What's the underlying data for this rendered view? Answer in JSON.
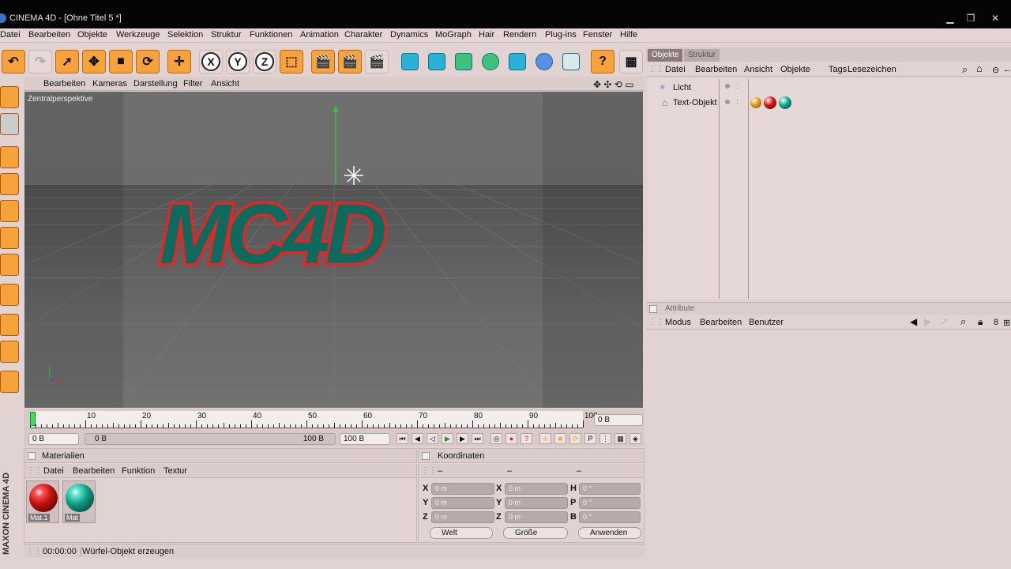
{
  "window": {
    "title": "CINEMA 4D - [Ohne Titel 5 *]"
  },
  "menu": [
    "Datei",
    "Bearbeiten",
    "Objekte",
    "Werkzeuge",
    "Selektion",
    "Struktur",
    "Funktionen",
    "Animation",
    "Charakter",
    "Dynamics",
    "MoGraph",
    "Hair",
    "Rendern",
    "Plug-ins",
    "Fenster",
    "Hilfe"
  ],
  "toolbar": {
    "axis_x": "X",
    "axis_y": "Y",
    "axis_z": "Z"
  },
  "viewport": {
    "menu": [
      "Bearbeiten",
      "Kameras",
      "Darstellung",
      "Filter",
      "Ansicht"
    ],
    "label": "Zentralperspektive",
    "scene_text": "MC4D"
  },
  "timeline": {
    "ticks": [
      "0",
      "10",
      "20",
      "30",
      "40",
      "50",
      "60",
      "70",
      "80",
      "90",
      "100"
    ],
    "current_frame": "0 B",
    "start_field": "0 B",
    "range_start": "0 B",
    "range_end": "100 B",
    "end_field": "100 B"
  },
  "materials": {
    "title": "Materialien",
    "menu": [
      "Datei",
      "Bearbeiten",
      "Funktion",
      "Textur"
    ],
    "items": [
      {
        "label": "Mat.1",
        "color": "#d81616"
      },
      {
        "label": "Mat",
        "color": "#10a88f"
      }
    ]
  },
  "coordinates": {
    "title": "Koordinaten",
    "col_headers": [
      "–",
      "–",
      "–"
    ],
    "rows": [
      {
        "a": "X",
        "av": "0 m",
        "b": "X",
        "bv": "0 m",
        "c": "H",
        "cv": "0 °"
      },
      {
        "a": "Y",
        "av": "0 m",
        "b": "Y",
        "bv": "0 m",
        "c": "P",
        "cv": "0 °"
      },
      {
        "a": "Z",
        "av": "0 m",
        "b": "Z",
        "bv": "0 m",
        "c": "B",
        "cv": "0 °"
      }
    ],
    "mode": "Welt",
    "size_mode": "Größe",
    "apply": "Anwenden"
  },
  "status": {
    "time": "00:00:00",
    "message": "Würfel-Objekt erzeugen"
  },
  "brand": {
    "text": "MAXON CINEMA 4D"
  },
  "objects": {
    "tabs": [
      "Objekte",
      "Struktur"
    ],
    "menu": [
      "Datei",
      "Bearbeiten",
      "Ansicht",
      "Objekte",
      "Tags",
      "Lesezeichen"
    ],
    "items": [
      {
        "name": "Licht"
      },
      {
        "name": "Text-Objekt"
      }
    ]
  },
  "attributes": {
    "title": "Attribute",
    "menu": [
      "Modus",
      "Bearbeiten",
      "Benutzer"
    ]
  },
  "colors": {
    "accent_orange": "#f7a23b",
    "panel_bg": "#e2d3d3",
    "logo_red": "#e02626",
    "logo_teal": "#0e6a5c"
  }
}
